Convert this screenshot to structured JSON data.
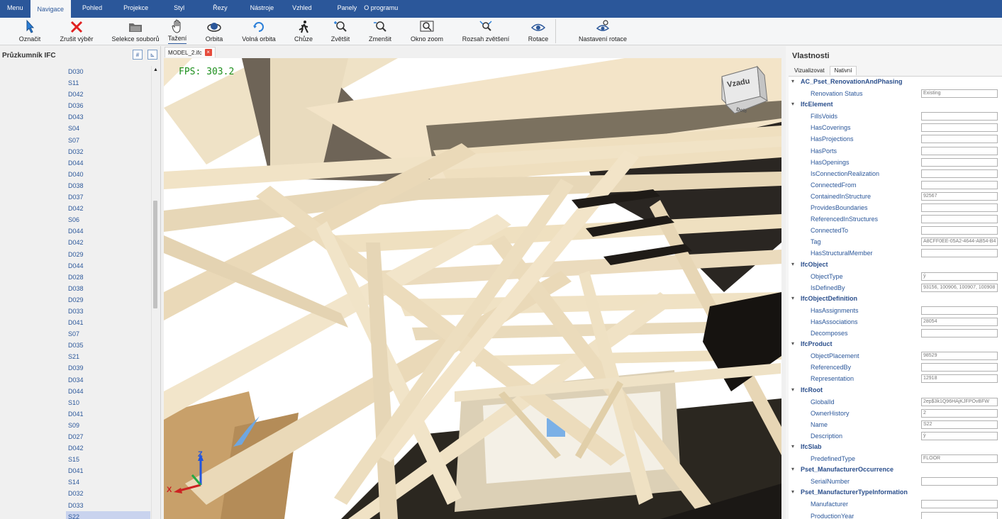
{
  "menubar": [
    "Menu",
    "Navigace",
    "Pohled",
    "Projekce",
    "Styl",
    "Řezy",
    "Nástroje",
    "Vzhled",
    "Panely",
    "O programu"
  ],
  "ribbon": {
    "buttons": [
      {
        "label": "Označit",
        "icon": "select-cursor-icon"
      },
      {
        "label": "Zrušit výběr",
        "icon": "red-x-icon"
      },
      {
        "label": "Selekce souborů",
        "icon": "folder-icon"
      },
      {
        "label": "Tažení",
        "icon": "hand-icon"
      },
      {
        "label": "Orbita",
        "icon": "orbit-icon"
      },
      {
        "label": "Volná orbita",
        "icon": "free-orbit-icon"
      },
      {
        "label": "Chůze",
        "icon": "walk-icon"
      },
      {
        "label": "Zvětšit",
        "icon": "zoom-in-icon"
      },
      {
        "label": "Zmenšit",
        "icon": "zoom-out-icon"
      },
      {
        "label": "Okno zoom",
        "icon": "zoom-window-icon"
      },
      {
        "label": "Rozsah zvětšení",
        "icon": "zoom-extents-icon"
      },
      {
        "label": "Rotace",
        "icon": "eye-rotate-icon"
      },
      {
        "label": "Nastavení rotace",
        "icon": "rotation-settings-icon"
      }
    ]
  },
  "explorer": {
    "title": "Průzkumník IFC",
    "items": [
      "D030",
      "S11",
      "D042",
      "D036",
      "D043",
      "S04",
      "S07",
      "D032",
      "D044",
      "D040",
      "D038",
      "D037",
      "D042",
      "S06",
      "D044",
      "D042",
      "D029",
      "D044",
      "D028",
      "D038",
      "D029",
      "D033",
      "D041",
      "S07",
      "D035",
      "S21",
      "D039",
      "D034",
      "D044",
      "S10",
      "D041",
      "S09",
      "D027",
      "D042",
      "S15",
      "D041",
      "S14",
      "D032",
      "D033",
      "S22"
    ],
    "selected_index": 39
  },
  "document": {
    "tab": "MODEL_2.ifc",
    "fps": "FPS: 303.2"
  },
  "viewcube": {
    "front": "Vzadu",
    "bottom": "Dole"
  },
  "axes": {
    "z": "Z",
    "x": "X"
  },
  "properties": {
    "title": "Vlastnosti",
    "tabs": [
      "Vizualizovat",
      "Nativní"
    ],
    "active_tab": 1,
    "rows": [
      {
        "type": "group",
        "name": "AC_Pset_RenovationAndPhasing"
      },
      {
        "type": "prop",
        "name": "Renovation Status",
        "value": "Existing"
      },
      {
        "type": "group",
        "name": "IfcElement"
      },
      {
        "type": "prop",
        "name": "FillsVoids",
        "value": ""
      },
      {
        "type": "prop",
        "name": "HasCoverings",
        "value": ""
      },
      {
        "type": "prop",
        "name": "HasProjections",
        "value": ""
      },
      {
        "type": "prop",
        "name": "HasPorts",
        "value": ""
      },
      {
        "type": "prop",
        "name": "HasOpenings",
        "value": ""
      },
      {
        "type": "prop",
        "name": "IsConnectionRealization",
        "value": ""
      },
      {
        "type": "prop",
        "name": "ConnectedFrom",
        "value": ""
      },
      {
        "type": "prop",
        "name": "ContainedInStructure",
        "value": "92567"
      },
      {
        "type": "prop",
        "name": "ProvidesBoundaries",
        "value": ""
      },
      {
        "type": "prop",
        "name": "ReferencedInStructures",
        "value": ""
      },
      {
        "type": "prop",
        "name": "ConnectedTo",
        "value": ""
      },
      {
        "type": "prop",
        "name": "Tag",
        "value": "A8CFF0EE-05A2-4644-AB54-B4"
      },
      {
        "type": "prop",
        "name": "HasStructuralMember",
        "value": ""
      },
      {
        "type": "group",
        "name": "IfcObject"
      },
      {
        "type": "prop",
        "name": "ObjectType",
        "value": "ý"
      },
      {
        "type": "prop",
        "name": "IsDefinedBy",
        "value": "93156, 100906, 100907, 100908"
      },
      {
        "type": "group",
        "name": "IfcObjectDefinition"
      },
      {
        "type": "prop",
        "name": "HasAssignments",
        "value": ""
      },
      {
        "type": "prop",
        "name": "HasAssociations",
        "value": "28054"
      },
      {
        "type": "prop",
        "name": "Decomposes",
        "value": ""
      },
      {
        "type": "group",
        "name": "IfcProduct"
      },
      {
        "type": "prop",
        "name": "ObjectPlacement",
        "value": "98529"
      },
      {
        "type": "prop",
        "name": "ReferencedBy",
        "value": ""
      },
      {
        "type": "prop",
        "name": "Representation",
        "value": "12918"
      },
      {
        "type": "group",
        "name": "IfcRoot"
      },
      {
        "type": "prop",
        "name": "GlobalId",
        "value": "2ep$3k1Q96HAjKJFPOvBFW"
      },
      {
        "type": "prop",
        "name": "OwnerHistory",
        "value": "2"
      },
      {
        "type": "prop",
        "name": "Name",
        "value": "S22"
      },
      {
        "type": "prop",
        "name": "Description",
        "value": "ý"
      },
      {
        "type": "group",
        "name": "IfcSlab"
      },
      {
        "type": "prop",
        "name": "PredefinedType",
        "value": "FLOOR"
      },
      {
        "type": "group",
        "name": "Pset_ManufacturerOccurrence"
      },
      {
        "type": "prop",
        "name": "SerialNumber",
        "value": ""
      },
      {
        "type": "group",
        "name": "Pset_ManufacturerTypeInformation"
      },
      {
        "type": "prop",
        "name": "Manufacturer",
        "value": ""
      },
      {
        "type": "prop",
        "name": "ProductionYear",
        "value": ""
      }
    ]
  },
  "colors": {
    "accent": "#2b579a",
    "timber": "#f3e4c8",
    "fps": "#1c8f1c"
  }
}
